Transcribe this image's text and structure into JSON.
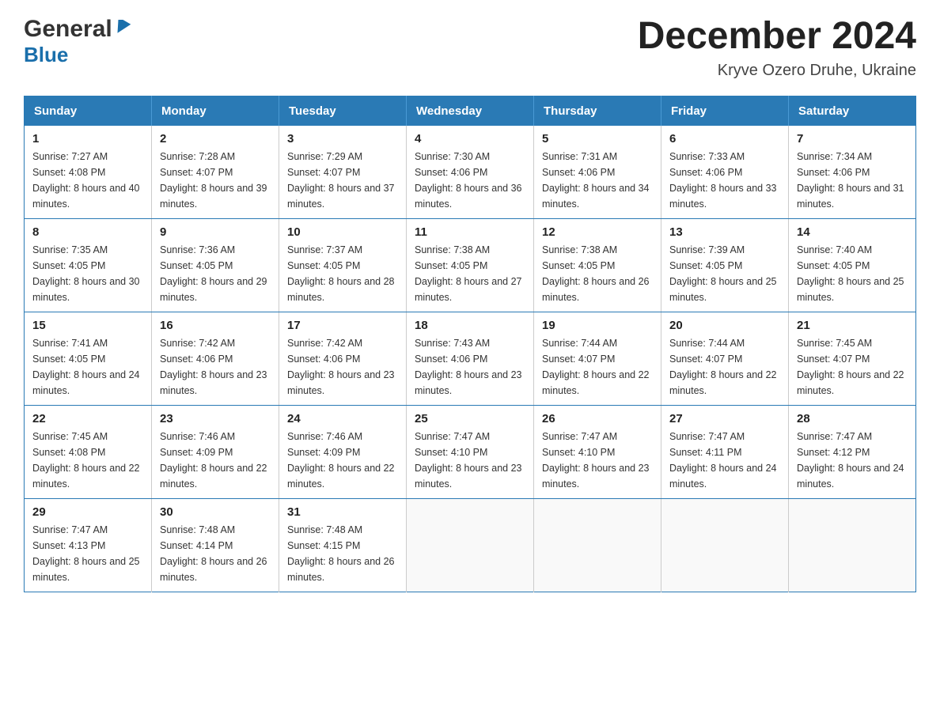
{
  "header": {
    "logo_general": "General",
    "logo_blue": "Blue",
    "month_title": "December 2024",
    "location": "Kryve Ozero Druhe, Ukraine"
  },
  "days_of_week": [
    "Sunday",
    "Monday",
    "Tuesday",
    "Wednesday",
    "Thursday",
    "Friday",
    "Saturday"
  ],
  "weeks": [
    [
      {
        "day": "1",
        "sunrise": "7:27 AM",
        "sunset": "4:08 PM",
        "daylight": "8 hours and 40 minutes."
      },
      {
        "day": "2",
        "sunrise": "7:28 AM",
        "sunset": "4:07 PM",
        "daylight": "8 hours and 39 minutes."
      },
      {
        "day": "3",
        "sunrise": "7:29 AM",
        "sunset": "4:07 PM",
        "daylight": "8 hours and 37 minutes."
      },
      {
        "day": "4",
        "sunrise": "7:30 AM",
        "sunset": "4:06 PM",
        "daylight": "8 hours and 36 minutes."
      },
      {
        "day": "5",
        "sunrise": "7:31 AM",
        "sunset": "4:06 PM",
        "daylight": "8 hours and 34 minutes."
      },
      {
        "day": "6",
        "sunrise": "7:33 AM",
        "sunset": "4:06 PM",
        "daylight": "8 hours and 33 minutes."
      },
      {
        "day": "7",
        "sunrise": "7:34 AM",
        "sunset": "4:06 PM",
        "daylight": "8 hours and 31 minutes."
      }
    ],
    [
      {
        "day": "8",
        "sunrise": "7:35 AM",
        "sunset": "4:05 PM",
        "daylight": "8 hours and 30 minutes."
      },
      {
        "day": "9",
        "sunrise": "7:36 AM",
        "sunset": "4:05 PM",
        "daylight": "8 hours and 29 minutes."
      },
      {
        "day": "10",
        "sunrise": "7:37 AM",
        "sunset": "4:05 PM",
        "daylight": "8 hours and 28 minutes."
      },
      {
        "day": "11",
        "sunrise": "7:38 AM",
        "sunset": "4:05 PM",
        "daylight": "8 hours and 27 minutes."
      },
      {
        "day": "12",
        "sunrise": "7:38 AM",
        "sunset": "4:05 PM",
        "daylight": "8 hours and 26 minutes."
      },
      {
        "day": "13",
        "sunrise": "7:39 AM",
        "sunset": "4:05 PM",
        "daylight": "8 hours and 25 minutes."
      },
      {
        "day": "14",
        "sunrise": "7:40 AM",
        "sunset": "4:05 PM",
        "daylight": "8 hours and 25 minutes."
      }
    ],
    [
      {
        "day": "15",
        "sunrise": "7:41 AM",
        "sunset": "4:05 PM",
        "daylight": "8 hours and 24 minutes."
      },
      {
        "day": "16",
        "sunrise": "7:42 AM",
        "sunset": "4:06 PM",
        "daylight": "8 hours and 23 minutes."
      },
      {
        "day": "17",
        "sunrise": "7:42 AM",
        "sunset": "4:06 PM",
        "daylight": "8 hours and 23 minutes."
      },
      {
        "day": "18",
        "sunrise": "7:43 AM",
        "sunset": "4:06 PM",
        "daylight": "8 hours and 23 minutes."
      },
      {
        "day": "19",
        "sunrise": "7:44 AM",
        "sunset": "4:07 PM",
        "daylight": "8 hours and 22 minutes."
      },
      {
        "day": "20",
        "sunrise": "7:44 AM",
        "sunset": "4:07 PM",
        "daylight": "8 hours and 22 minutes."
      },
      {
        "day": "21",
        "sunrise": "7:45 AM",
        "sunset": "4:07 PM",
        "daylight": "8 hours and 22 minutes."
      }
    ],
    [
      {
        "day": "22",
        "sunrise": "7:45 AM",
        "sunset": "4:08 PM",
        "daylight": "8 hours and 22 minutes."
      },
      {
        "day": "23",
        "sunrise": "7:46 AM",
        "sunset": "4:09 PM",
        "daylight": "8 hours and 22 minutes."
      },
      {
        "day": "24",
        "sunrise": "7:46 AM",
        "sunset": "4:09 PM",
        "daylight": "8 hours and 22 minutes."
      },
      {
        "day": "25",
        "sunrise": "7:47 AM",
        "sunset": "4:10 PM",
        "daylight": "8 hours and 23 minutes."
      },
      {
        "day": "26",
        "sunrise": "7:47 AM",
        "sunset": "4:10 PM",
        "daylight": "8 hours and 23 minutes."
      },
      {
        "day": "27",
        "sunrise": "7:47 AM",
        "sunset": "4:11 PM",
        "daylight": "8 hours and 24 minutes."
      },
      {
        "day": "28",
        "sunrise": "7:47 AM",
        "sunset": "4:12 PM",
        "daylight": "8 hours and 24 minutes."
      }
    ],
    [
      {
        "day": "29",
        "sunrise": "7:47 AM",
        "sunset": "4:13 PM",
        "daylight": "8 hours and 25 minutes."
      },
      {
        "day": "30",
        "sunrise": "7:48 AM",
        "sunset": "4:14 PM",
        "daylight": "8 hours and 26 minutes."
      },
      {
        "day": "31",
        "sunrise": "7:48 AM",
        "sunset": "4:15 PM",
        "daylight": "8 hours and 26 minutes."
      },
      null,
      null,
      null,
      null
    ]
  ]
}
